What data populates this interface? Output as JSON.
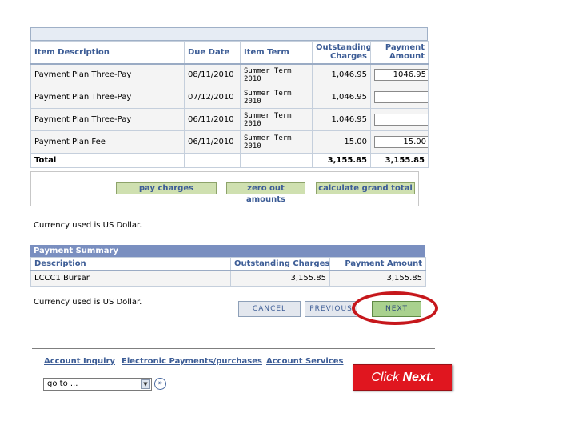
{
  "charges_table": {
    "headers": {
      "description": "Item Description",
      "due_date": "Due Date",
      "item_term": "Item Term",
      "outstanding": "Outstanding Charges",
      "payment": "Payment Amount"
    },
    "rows": [
      {
        "description": "Payment Plan Three-Pay",
        "due_date": "08/11/2010",
        "term": "Summer Term 2010",
        "outstanding": "1,046.95",
        "payment": "1046.95"
      },
      {
        "description": "Payment Plan Three-Pay",
        "due_date": "07/12/2010",
        "term": "Summer Term 2010",
        "outstanding": "1,046.95",
        "payment": ""
      },
      {
        "description": "Payment Plan Three-Pay",
        "due_date": "06/11/2010",
        "term": "Summer Term 2010",
        "outstanding": "1,046.95",
        "payment": ""
      },
      {
        "description": "Payment Plan Fee",
        "due_date": "06/11/2010",
        "term": "Summer Term 2010",
        "outstanding": "15.00",
        "payment": "15.00"
      }
    ],
    "total": {
      "label": "Total",
      "outstanding": "3,155.85",
      "payment": "3,155.85"
    }
  },
  "actions": {
    "pay_charges": "pay charges",
    "zero_out": "zero out amounts",
    "calc_total": "calculate grand total"
  },
  "currency_note": "Currency used is US Dollar.",
  "summary": {
    "title": "Payment Summary",
    "headers": {
      "description": "Description",
      "outstanding": "Outstanding Charges",
      "payment": "Payment Amount"
    },
    "row": {
      "description": "LCCC1 Bursar",
      "outstanding": "3,155.85",
      "payment": "3,155.85"
    }
  },
  "nav": {
    "cancel": "CANCEL",
    "previous": "PREVIOUS",
    "next": "NEXT"
  },
  "footer": {
    "links": [
      "Account Inquiry",
      "Electronic Payments/purchases",
      "Account Services"
    ],
    "goto_value": "go to ..."
  },
  "callout": {
    "prefix": "Click ",
    "bold": "Next."
  },
  "colors": {
    "header_text": "#3d5d96",
    "summary_bar": "#7a8fc0",
    "button_green": "#cfe0b0",
    "callout_red": "#e0161f",
    "ellipse_red": "#c6171c"
  },
  "icons": {
    "select_arrow": "chevron-down-icon",
    "go": "double-chevron-right-icon"
  }
}
